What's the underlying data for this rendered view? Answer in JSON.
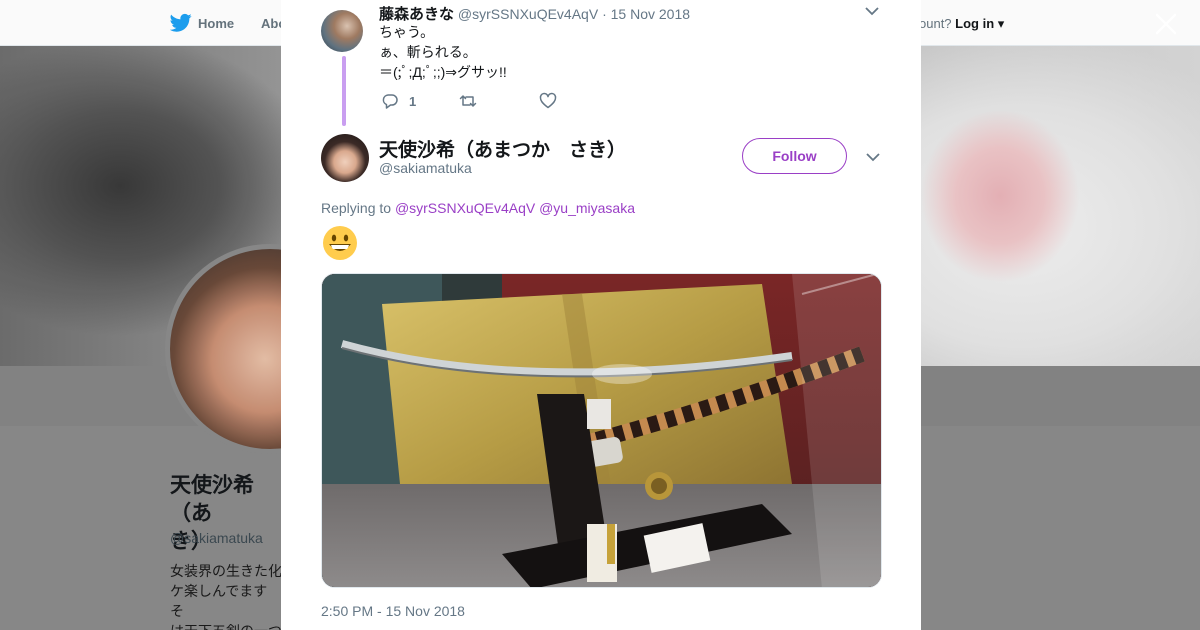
{
  "topnav": {
    "home_label": "Home",
    "about_label": "Abo",
    "account_prompt": "ccount?",
    "login_label": "Log in"
  },
  "profile": {
    "name": "天使沙希（あまつか　さき）",
    "name_visible_line1": "天使沙希（あ",
    "name_visible_line2": "き）",
    "handle": "@sakiamatuka",
    "bio_visible": "女装界の生きた化\nケ楽しんでます そ\nは天下五剣の一つ\nこう見えて不老不"
  },
  "reply_tweet": {
    "display_name": "藤森あきな",
    "handle": "@syrSSNXuQEv4AqV",
    "separator": "·",
    "date": "15 Nov 2018",
    "text": "ちゃう。\nぁ、斬られる。\n＝(;ﾟ;Д;ﾟ;;)⇒グサッ!!",
    "reply_count": "1",
    "retweet_count": "",
    "like_count": ""
  },
  "main_tweet": {
    "display_name": "天使沙希（あまつか　さき）",
    "handle": "@sakiamatuka",
    "follow_label": "Follow",
    "replying_prefix": "Replying to",
    "mention_1": "@syrSSNXuQEv4AqV",
    "mention_2": "@yu_miyasaka",
    "timestamp": "2:50 PM - 15 Nov 2018"
  },
  "icons": {
    "brand": "twitter-bird-icon",
    "close": "close-icon",
    "reply": "reply-icon",
    "retweet": "retweet-icon",
    "like": "heart-icon",
    "caret": "chevron-down-icon",
    "emoji": "grinning-face-emoji"
  },
  "colors": {
    "twitter_blue": "#1da1f2",
    "accent_purple": "#9a3fc6",
    "thread_line": "#c99ef0",
    "muted_text": "#657786"
  }
}
